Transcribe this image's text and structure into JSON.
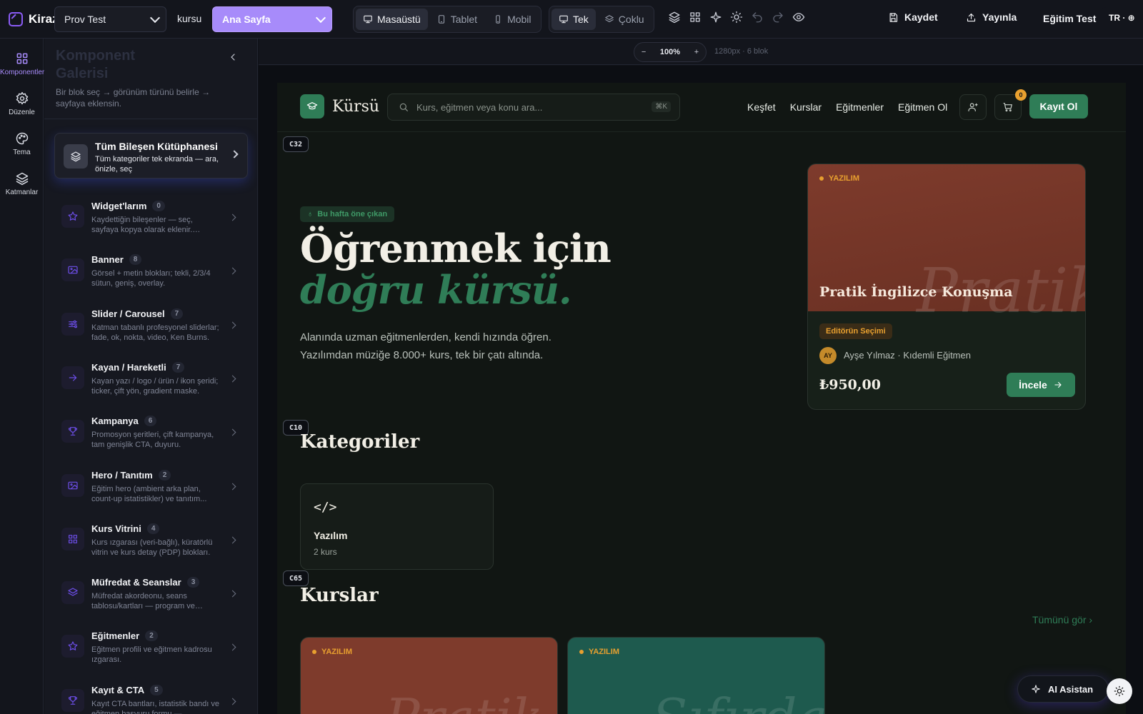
{
  "app": {
    "brand": "Kiraz",
    "site_select": "Prov Test",
    "site_slug": "kursu",
    "page_select": "Ana Sayfa",
    "user": "Eğitim Test",
    "lang": "TR · ⊕"
  },
  "device_toggle": [
    {
      "label": "Masaüstü",
      "icon": "monitor-icon",
      "active": true
    },
    {
      "label": "Tablet",
      "icon": "tablet-icon",
      "active": false
    },
    {
      "label": "Mobil",
      "icon": "phone-icon",
      "active": false
    }
  ],
  "view_toggle": [
    {
      "label": "Tek",
      "icon": "monitor-icon",
      "active": true
    },
    {
      "label": "Çoklu",
      "icon": "layers-icon",
      "active": false
    }
  ],
  "actions": {
    "save": "Kaydet",
    "publish": "Yayınla"
  },
  "rail": [
    {
      "label": "Komponentler",
      "icon": "grid-icon",
      "active": true
    },
    {
      "label": "Düzenle",
      "icon": "gear-icon"
    },
    {
      "label": "Tema",
      "icon": "palette-icon"
    },
    {
      "label": "Katmanlar",
      "icon": "layers-icon"
    }
  ],
  "sidebar": {
    "title": "Komponent Galerisi",
    "description": "Bir blok seç → görünüm türünü belirle → sayfaya eklensin.",
    "library": {
      "title": "Tüm Bileşen Kütüphanesi",
      "description": "Tüm kategoriler tek ekranda — ara, önizle, seç"
    },
    "categories": [
      {
        "label": "Widget'larım",
        "count": "0",
        "description": "Kaydettiğin bileşenler — seç, sayfaya kopya olarak eklenir. Canvas'ta bir...",
        "icon": "star-icon"
      },
      {
        "label": "Banner",
        "count": "8",
        "description": "Görsel + metin blokları; tekli, 2/3/4 sütun, geniş, overlay.",
        "icon": "image-icon"
      },
      {
        "label": "Slider / Carousel",
        "count": "7",
        "description": "Katman tabanlı profesyonel sliderlar; fade, ok, nokta, video, Ken Burns.",
        "icon": "sliders-icon"
      },
      {
        "label": "Kayan / Hareketli",
        "count": "7",
        "description": "Kayan yazı / logo / ürün / ikon şeridi; ticker, çift yön, gradient maske.",
        "icon": "arrow-right-icon"
      },
      {
        "label": "Kampanya",
        "count": "6",
        "description": "Promosyon şeritleri, çift kampanya, tam genişlik CTA, duyuru.",
        "icon": "trophy-icon"
      },
      {
        "label": "Hero / Tanıtım",
        "count": "2",
        "description": "Eğitim hero (ambient arka plan, count-up istatistikler) ve tanıtım...",
        "icon": "image-icon"
      },
      {
        "label": "Kurs Vitrini",
        "count": "4",
        "description": "Kurs ızgarası (veri-bağlı), küratörlü vitrin ve kurs detay (PDP) blokları.",
        "icon": "grid-icon"
      },
      {
        "label": "Müfredat & Seanslar",
        "count": "3",
        "description": "Müfredat akordeonu, seans tablosu/kartları — program ve içerik...",
        "icon": "layers-icon"
      },
      {
        "label": "Eğitmenler",
        "count": "2",
        "description": "Eğitmen profili ve eğitmen kadrosu ızgarası.",
        "icon": "star-icon"
      },
      {
        "label": "Kayıt & CTA",
        "count": "5",
        "description": "Kayıt CTA bantları, istatistik bandı ve eğitmen başvuru formu — dönüşüm...",
        "icon": "trophy-icon"
      }
    ]
  },
  "canvas": {
    "zoom": "100%",
    "meta": "1280px · 6 blok",
    "zoom_out": "−",
    "zoom_in": "+"
  },
  "site": {
    "brand": "Kürsü",
    "search_placeholder": "Kurs, eğitmen veya konu ara...",
    "search_kbd": "⌘K",
    "nav": [
      "Keşfet",
      "Kurslar",
      "Eğitmenler",
      "Eğitmen Ol"
    ],
    "cart_count": "0",
    "signup": "Kayıt Ol",
    "block_tags": [
      "C32",
      "C10",
      "C65"
    ],
    "hero": {
      "badge": "Bu hafta öne çıkan",
      "title_line1": "Öğrenmek için",
      "title_line2": "doğru kürsü.",
      "lead": "Alanında uzman eğitmenlerden, kendi hızında öğren. Yazılımdan müziğe 8.000+ kurs, tek bir çatı altında."
    },
    "featured": {
      "category": "YAZILIM",
      "watermark": "Pratik",
      "title": "Pratik İngilizce Konuşma",
      "pick": "Editörün Seçimi",
      "avatar": "AY",
      "author": "Ayşe Yılmaz · Kıdemli Eğitmen",
      "price": "₺950,00",
      "cta": "İncele"
    },
    "categories_title": "Kategoriler",
    "category_card": {
      "glyph": "</>",
      "name": "Yazılım",
      "count": "2 kurs"
    },
    "courses_title": "Kurslar",
    "see_all": "Tümünü gör ›",
    "courses": [
      {
        "category": "YAZILIM",
        "watermark": "Pratik",
        "color": "#7e3b2c"
      },
      {
        "category": "YAZILIM",
        "watermark": "Sıfırdan",
        "color": "#1e5a4e"
      }
    ]
  },
  "ai_assistant": "AI Asistan",
  "colors": {
    "accent": "#8b5cf6",
    "site_green": "#2f7d57",
    "amber": "#e8a02f"
  }
}
